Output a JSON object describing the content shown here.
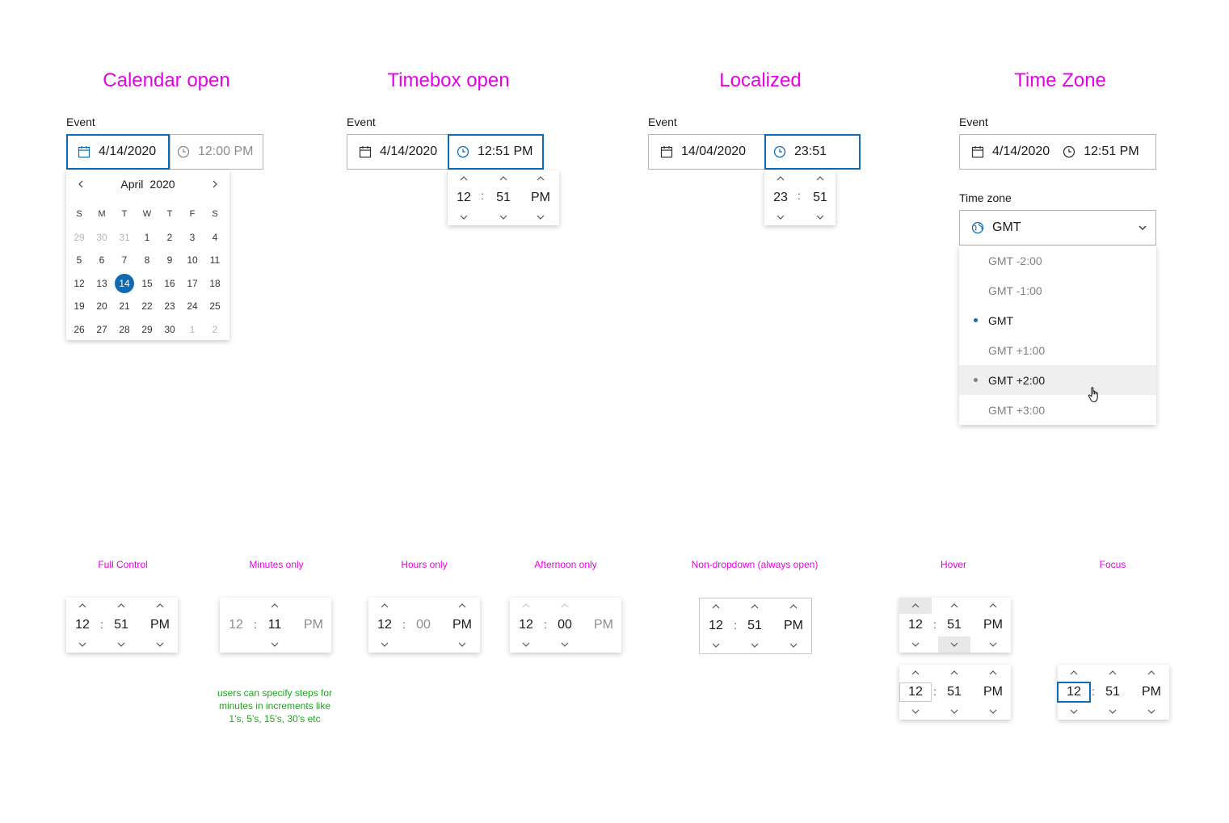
{
  "headings": {
    "calendar_open": "Calendar open",
    "timebox_open": "Timebox open",
    "localized": "Localized",
    "time_zone": "Time Zone"
  },
  "event_label": "Event",
  "calendar_open": {
    "date": "4/14/2020",
    "time": "12:00 PM",
    "calendar": {
      "month": "April",
      "year": "2020",
      "weekdays": [
        "S",
        "M",
        "T",
        "W",
        "T",
        "F",
        "S"
      ],
      "weeks": [
        [
          "29",
          "30",
          "31",
          "1",
          "2",
          "3",
          "4"
        ],
        [
          "5",
          "6",
          "7",
          "8",
          "9",
          "10",
          "11"
        ],
        [
          "12",
          "13",
          "14",
          "15",
          "16",
          "17",
          "18"
        ],
        [
          "19",
          "20",
          "21",
          "22",
          "23",
          "24",
          "25"
        ],
        [
          "26",
          "27",
          "28",
          "29",
          "30",
          "1",
          "2"
        ]
      ],
      "selected": "14"
    }
  },
  "timebox_open": {
    "date": "4/14/2020",
    "time": "12:51 PM",
    "hour": "12",
    "minute": "51",
    "period": "PM"
  },
  "localized": {
    "date": "14/04/2020",
    "time": "23:51",
    "hour": "23",
    "minute": "51"
  },
  "time_zone": {
    "date": "4/14/2020",
    "time": "12:51 PM",
    "label": "Time zone",
    "selected": "GMT",
    "options": [
      "GMT -2:00",
      "GMT -1:00",
      "GMT",
      "GMT +1:00",
      "GMT +2:00",
      "GMT +3:00"
    ],
    "selected_index": 2,
    "hover_index": 4
  },
  "variants": {
    "full_control": {
      "title": "Full Control",
      "hour": "12",
      "minute": "51",
      "period": "PM"
    },
    "minutes_only": {
      "title": "Minutes only",
      "hour": "12",
      "minute": "11",
      "period": "PM",
      "note": [
        "users can specify steps for",
        "minutes in increments like",
        "1’s, 5’s, 15’s, 30’s etc"
      ]
    },
    "hours_only": {
      "title": "Hours only",
      "hour": "12",
      "minute": "00",
      "period": "PM"
    },
    "afternoon_only": {
      "title": "Afternoon only",
      "hour": "12",
      "minute": "00",
      "period": "PM"
    },
    "non_dropdown": {
      "title": "Non-dropdown (always open)",
      "hour": "12",
      "minute": "51",
      "period": "PM"
    },
    "hover": {
      "title": "Hover",
      "hour": "12",
      "minute": "51",
      "period": "PM"
    },
    "focus": {
      "title": "Focus",
      "hour": "12",
      "minute": "51",
      "period": "PM"
    }
  },
  "colors": {
    "accent": "#0f6ab4",
    "heading": "#e600e6",
    "note": "#1fa51f"
  }
}
